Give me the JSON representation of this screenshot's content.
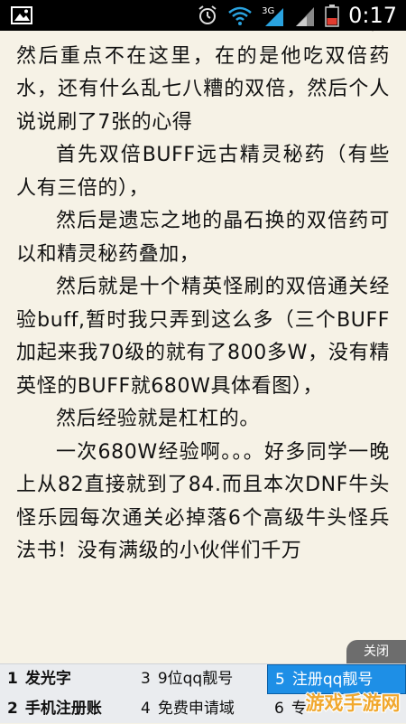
{
  "status_bar": {
    "time": "0:17",
    "network_label": "3G"
  },
  "article": {
    "paragraphs": [
      {
        "text": "首先牛头怪乐园好像是四倍经验了，然后重点不在这里，在的是他吃双倍药水，还有什么乱七八糟的双倍，然后个人说说刷了7张的心得",
        "indent": true
      },
      {
        "text": "首先双倍BUFF远古精灵秘药（有些人有三倍的），",
        "indent": true
      },
      {
        "text": "然后是遗忘之地的晶石换的双倍药可以和精灵秘药叠加，",
        "indent": true
      },
      {
        "text": "然后就是十个精英怪刷的双倍通关经验buff,暂时我只弄到这么多（三个BUFF加起来我70级的就有了800多W，没有精英怪的BUFF就680W具体看图），",
        "indent": true
      },
      {
        "text": "然后经验就是杠杠的。",
        "indent": true
      },
      {
        "text": "一次680W经验啊。。。好多同学一晚上从82直接就到了84.而且本次DNF牛头怪乐园每次通关必掉落6个高级牛头怪兵法书！没有满级的小伙伴们千万",
        "indent": true
      }
    ]
  },
  "close_button": {
    "label": "关闭"
  },
  "ad_bar": {
    "items": [
      {
        "num": "1",
        "label": "发光字",
        "bold": true,
        "highlight": false
      },
      {
        "num": "3",
        "label": "9位qq靓号",
        "bold": false,
        "highlight": false
      },
      {
        "num": "5",
        "label": "注册qq靓号",
        "bold": false,
        "highlight": true
      },
      {
        "num": "2",
        "label": "手机注册账",
        "bold": true,
        "highlight": false
      },
      {
        "num": "4",
        "label": "免费申请域",
        "bold": false,
        "highlight": false
      },
      {
        "num": "6",
        "label": "专",
        "bold": false,
        "highlight": false
      }
    ]
  },
  "watermark": {
    "text": "游戏手游网"
  },
  "colors": {
    "page_background": "#f6f2e6",
    "status_bar": "#000000",
    "signal_accent": "#2aa3e0",
    "ad_highlight": "#1e8fe6",
    "watermark": "#f2a11a"
  }
}
